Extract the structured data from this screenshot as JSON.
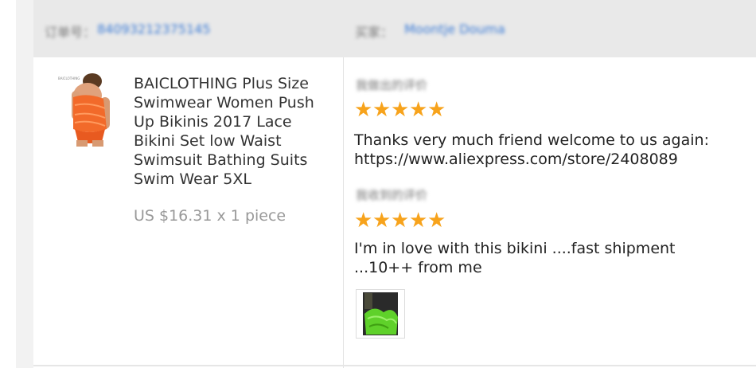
{
  "order": {
    "label": "订单号：",
    "number": "84093212375145"
  },
  "buyer": {
    "label": "买家：",
    "name": "Moontje Douma"
  },
  "product": {
    "title": "BAICLOTHING Plus Size Swimwear Women Push Up Bikinis 2017 Lace Bikini Set low Waist Swimsuit Bathing Suits Swim Wear 5XL",
    "price": "US $16.31 x 1 piece",
    "thumb_label": "BAICLOTHING"
  },
  "feedback": {
    "seller_reply": {
      "label": "我做出的评价",
      "stars": 5,
      "text": "Thanks very much friend welcome to us again: https://www.aliexpress.com/store/2408089"
    },
    "buyer_review": {
      "label": "我收到的评价",
      "stars": 5,
      "text": "I'm in love with this bikini ....fast shipment ...10++ from me",
      "has_photo": true
    }
  },
  "colors": {
    "star": "#f7a31c",
    "link": "#3b7bd6",
    "header_bg": "#e9e9e9"
  }
}
